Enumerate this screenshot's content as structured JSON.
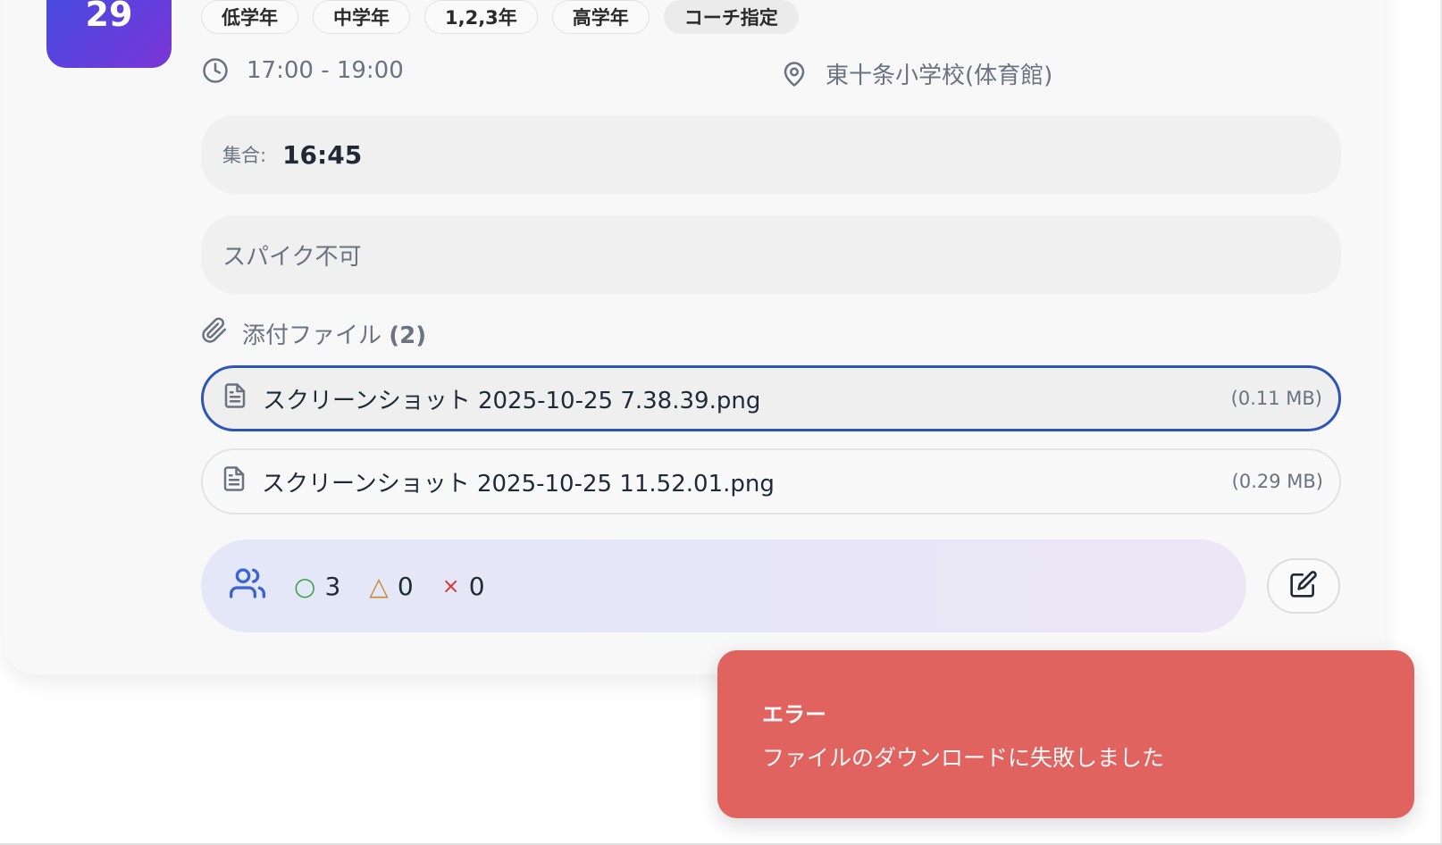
{
  "event": {
    "day": "29",
    "tags": [
      "低学年",
      "中学年",
      "1,2,3年",
      "高学年",
      "コーチ指定"
    ],
    "time": "17:00 - 19:00",
    "location": "東十条小学校(体育館)",
    "assembly_label": "集合:",
    "assembly_time": "16:45",
    "note": "スパイク不可"
  },
  "attachments": {
    "label": "添付ファイル",
    "count": "(2)",
    "files": [
      {
        "name": "スクリーンショット 2025-10-25 7.38.39.png",
        "size": "(0.11 MB)"
      },
      {
        "name": "スクリーンショット 2025-10-25 11.52.01.png",
        "size": "(0.29 MB)"
      }
    ]
  },
  "responses": {
    "yes_symbol": "○",
    "yes": "3",
    "maybe_symbol": "△",
    "maybe": "0",
    "no_symbol": "×",
    "no": "0"
  },
  "toast": {
    "title": "エラー",
    "message": "ファイルのダウンロードに失敗しました"
  },
  "colors": {
    "accent_blue": "#2d55b8",
    "toast_red": "#e06360",
    "yes_green": "#3fa34d",
    "maybe_orange": "#c98a2b",
    "no_red": "#d23c3c"
  }
}
